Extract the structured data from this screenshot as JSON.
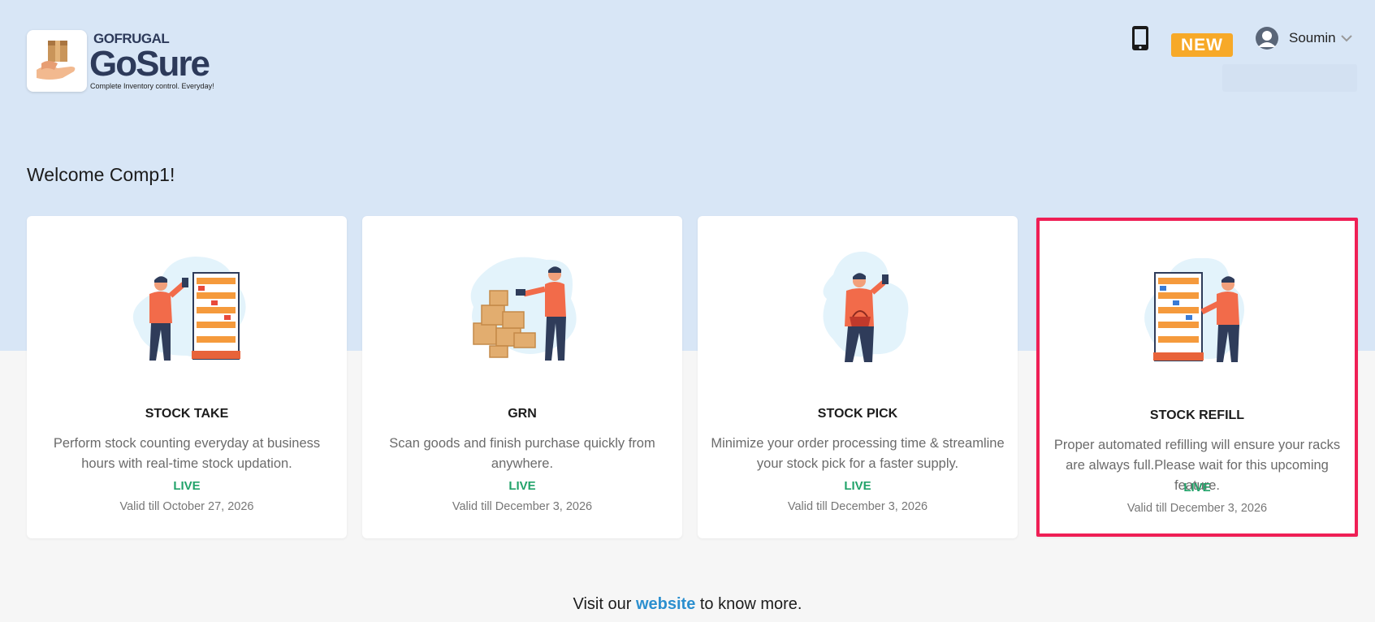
{
  "header": {
    "brand_top": "GOFRUGAL",
    "brand_main": "GoSure",
    "brand_tagline": "Complete Inventory control. Everyday!",
    "new_badge": "NEW",
    "user_name": "Soumin"
  },
  "welcome": "Welcome Comp1!",
  "cards": [
    {
      "title": "STOCK TAKE",
      "description": "Perform stock counting everyday at business hours with real-time stock updation.",
      "status": "LIVE",
      "validity": "Valid till October 27, 2026",
      "illustration": "person-scanning-shelf-icon"
    },
    {
      "title": "GRN",
      "description": "Scan goods and finish purchase quickly from anywhere.",
      "status": "LIVE",
      "validity": "Valid till December 3, 2026",
      "illustration": "person-scanning-boxes-icon"
    },
    {
      "title": "STOCK PICK",
      "description": "Minimize your order processing time & streamline your stock pick for a faster supply.",
      "status": "LIVE",
      "validity": "Valid till December 3, 2026",
      "illustration": "person-with-basket-icon"
    },
    {
      "title": "STOCK REFILL",
      "description": "Proper automated refilling will ensure your racks are always full.Please wait for this upcoming feature.",
      "status": "LIVE",
      "validity": "Valid till December 3, 2026",
      "illustration": "person-refilling-shelf-icon"
    }
  ],
  "footer": {
    "prefix": "Visit our",
    "link": "website",
    "suffix": "to know more."
  },
  "colors": {
    "top_band": "#d8e6f6",
    "live": "#22a36a",
    "new_badge": "#f7a928",
    "highlight_border": "#ef1f55",
    "link": "#2b8fcf"
  }
}
